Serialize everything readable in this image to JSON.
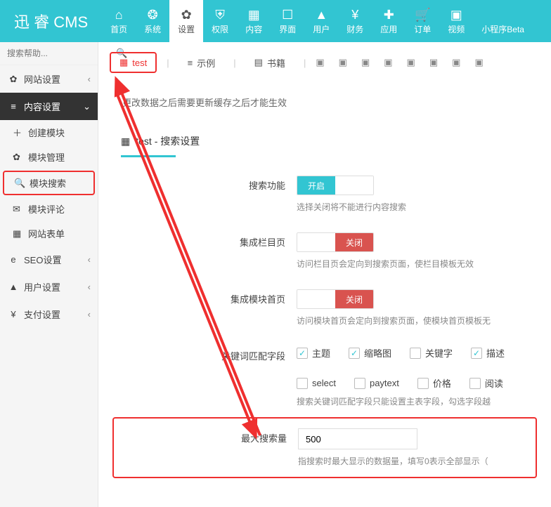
{
  "brand": "迅 睿 CMS",
  "topnav": [
    {
      "icon": "⌂",
      "label": "首页"
    },
    {
      "icon": "❂",
      "label": "系统"
    },
    {
      "icon": "✿",
      "label": "设置",
      "active": true
    },
    {
      "icon": "⛨",
      "label": "权限"
    },
    {
      "icon": "▦",
      "label": "内容"
    },
    {
      "icon": "☐",
      "label": "界面"
    },
    {
      "icon": "▲",
      "label": "用户"
    },
    {
      "icon": "¥",
      "label": "财务"
    },
    {
      "icon": "✚",
      "label": "应用"
    },
    {
      "icon": "🛒",
      "label": "订单"
    },
    {
      "icon": "▣",
      "label": "视频"
    },
    {
      "icon": "</>",
      "label": "小程序Beta"
    }
  ],
  "search": {
    "placeholder": "搜索帮助..."
  },
  "sidebar": {
    "site": {
      "icon": "✿",
      "label": "网站设置"
    },
    "content": {
      "icon": "≡",
      "label": "内容设置"
    },
    "subs": [
      {
        "icon": "＋",
        "label": "创建模块"
      },
      {
        "icon": "✿",
        "label": "模块管理"
      },
      {
        "icon": "🔍",
        "label": "模块搜索",
        "highlight": true
      },
      {
        "icon": "✉",
        "label": "模块评论"
      },
      {
        "icon": "▦",
        "label": "网站表单"
      }
    ],
    "seo": {
      "icon": "e",
      "label": "SEO设置"
    },
    "user": {
      "icon": "▲",
      "label": "用户设置"
    },
    "pay": {
      "icon": "¥",
      "label": "支付设置"
    }
  },
  "tabs": {
    "test": {
      "icon": "▦",
      "label": "test"
    },
    "demo": {
      "icon": "≡",
      "label": "示例"
    },
    "book": {
      "icon": "▤",
      "label": "书籍"
    }
  },
  "notice": "更改数据之后需要更新缓存之后才能生效",
  "panel": {
    "title": "test - 搜索设置",
    "icon": "▦"
  },
  "form": {
    "search_func": {
      "label": "搜索功能",
      "on": "开启",
      "help": "选择关闭将不能进行内容搜索"
    },
    "cat_page": {
      "label": "集成栏目页",
      "off": "关闭",
      "help": "访问栏目页会定向到搜索页面，使栏目模板无效"
    },
    "mod_home": {
      "label": "集成模块首页",
      "off": "关闭",
      "help": "访问模块首页会定向到搜索页面，使模块首页模板无"
    },
    "fields": {
      "label": "关键词匹配字段",
      "help": "搜索关键词匹配字段只能设置主表字段，勾选字段越"
    },
    "chips": [
      {
        "label": "主题",
        "checked": true
      },
      {
        "label": "缩略图",
        "checked": true
      },
      {
        "label": "关键字",
        "checked": false
      },
      {
        "label": "描述",
        "checked": true
      },
      {
        "label": "select",
        "checked": false
      },
      {
        "label": "paytext",
        "checked": false
      },
      {
        "label": "价格",
        "checked": false
      },
      {
        "label": "阅读",
        "checked": false
      }
    ],
    "max": {
      "label": "最大搜索量",
      "value": "500",
      "help": "指搜索时最大显示的数据量，填写0表示全部显示（"
    }
  }
}
